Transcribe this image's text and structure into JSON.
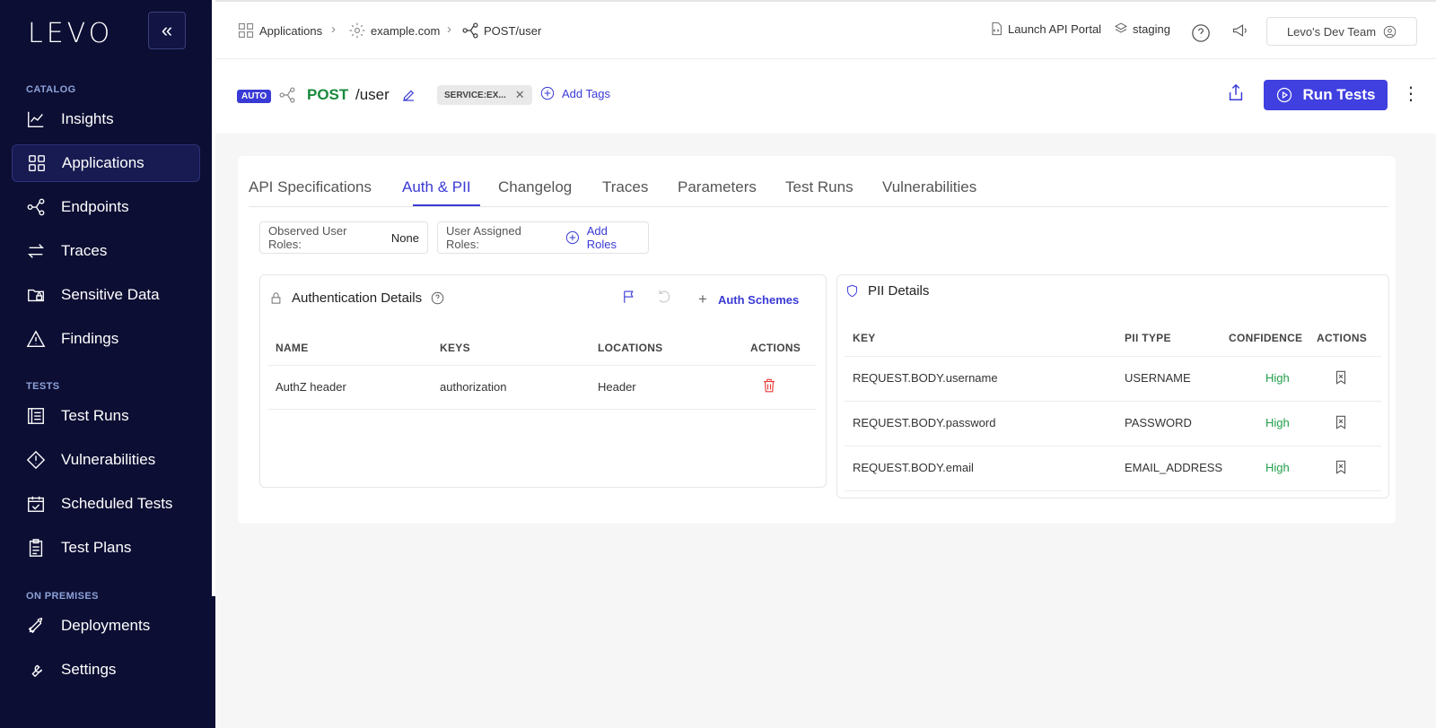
{
  "sidebar": {
    "logo": "LEVO",
    "collapse_icon": "double-chevron-left-icon",
    "sections": {
      "catalog": "CATALOG",
      "tests": "TESTS",
      "on_premises": "ON PREMISES"
    },
    "items": [
      {
        "label": "Insights",
        "icon": "chart-line-icon"
      },
      {
        "label": "Applications",
        "icon": "grid-icon",
        "active": true
      },
      {
        "label": "Endpoints",
        "icon": "endpoints-icon"
      },
      {
        "label": "Traces",
        "icon": "arrows-icon"
      },
      {
        "label": "Sensitive Data",
        "icon": "folder-lock-icon"
      },
      {
        "label": "Findings",
        "icon": "warning-icon"
      },
      {
        "label": "Test Runs",
        "icon": "list-icon"
      },
      {
        "label": "Vulnerabilities",
        "icon": "diamond-alert-icon"
      },
      {
        "label": "Scheduled Tests",
        "icon": "calendar-check-icon"
      },
      {
        "label": "Test Plans",
        "icon": "clipboard-icon"
      },
      {
        "label": "Deployments",
        "icon": "rocket-icon"
      },
      {
        "label": "Settings",
        "icon": "wrench-icon"
      }
    ]
  },
  "topbar": {
    "breadcrumbs": [
      "Applications",
      "example.com",
      "POST/user"
    ],
    "launch_portal": "Launch API Portal",
    "environment": "staging",
    "team": "Levo's Dev Team"
  },
  "header": {
    "badge": "AUTO",
    "method": "POST",
    "path": "/user",
    "tag": "SERVICE:EX...",
    "add_tags": "Add Tags",
    "run_tests": "Run Tests",
    "more": "⋮"
  },
  "tabs": [
    "API Specifications",
    "Auth & PII",
    "Changelog",
    "Traces",
    "Parameters",
    "Test Runs",
    "Vulnerabilities"
  ],
  "active_tab": "Auth & PII",
  "roles": {
    "observed_label": "Observed User Roles:",
    "observed_value": "None",
    "assigned_label": "User Assigned Roles:",
    "add_roles": "Add Roles"
  },
  "auth": {
    "title": "Authentication Details",
    "add_schemes": "Auth Schemes",
    "columns": [
      "NAME",
      "KEYS",
      "LOCATIONS",
      "ACTIONS"
    ],
    "rows": [
      {
        "name": "AuthZ header",
        "key": "authorization",
        "location": "Header"
      }
    ]
  },
  "pii": {
    "title": "PII Details",
    "columns": [
      "KEY",
      "PII TYPE",
      "CONFIDENCE",
      "ACTIONS"
    ],
    "rows": [
      {
        "key": "REQUEST.BODY.username",
        "type": "USERNAME",
        "confidence": "High"
      },
      {
        "key": "REQUEST.BODY.password",
        "type": "PASSWORD",
        "confidence": "High"
      },
      {
        "key": "REQUEST.BODY.email",
        "type": "EMAIL_ADDRESS",
        "confidence": "High"
      }
    ]
  },
  "colors": {
    "accent": "#3a3ad6",
    "sidebar_bg": "#0c0e33",
    "method_green": "#188a3c",
    "high_green": "#22a04b",
    "delete_red": "#e53935"
  }
}
